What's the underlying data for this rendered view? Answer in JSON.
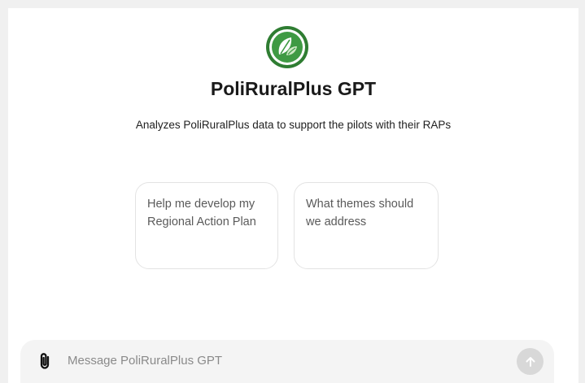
{
  "app": {
    "title": "PoliRuralPlus GPT",
    "description": "Analyzes PoliRuralPlus data to support the pilots with their RAPs",
    "logo_icon": "leaf-logo-icon",
    "accent_color": "#3a8a3a"
  },
  "suggestions": [
    {
      "label": "Help me develop my Regional Action Plan"
    },
    {
      "label": "What themes should we address"
    }
  ],
  "composer": {
    "placeholder": "Message PoliRuralPlus GPT",
    "attach_icon": "paperclip-icon",
    "send_icon": "arrow-up-icon"
  }
}
